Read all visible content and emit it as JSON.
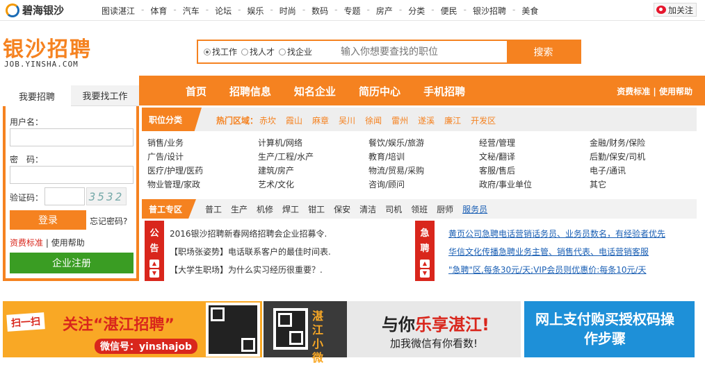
{
  "top_bar": {
    "logo_text": "碧海银沙",
    "nav": [
      "图读湛江",
      "体育",
      "汽车",
      "论坛",
      "娱乐",
      "时尚",
      "数码",
      "专题",
      "房产",
      "分类",
      "便民",
      "银沙招聘",
      "美食"
    ],
    "weibo_follow": "加关注"
  },
  "brand": {
    "title": "银沙招聘",
    "subtitle": "JOB.YINSHA.COM"
  },
  "search": {
    "options": [
      {
        "label": "找工作",
        "selected": true
      },
      {
        "label": "找人才",
        "selected": false
      },
      {
        "label": "找企业",
        "selected": false
      }
    ],
    "placeholder": "输入你想要查找的职位",
    "button": "搜索"
  },
  "main_nav": {
    "items": [
      "首页",
      "招聘信息",
      "知名企业",
      "简历中心",
      "手机招聘"
    ],
    "right": "资费标准 | 使用帮助"
  },
  "login": {
    "tabs": [
      "我要招聘",
      "我要找工作"
    ],
    "username_label": "用户名：",
    "password_label": "密　码：",
    "captcha_label": "验证码：",
    "captcha_text": "3532",
    "login_button": "登录",
    "forgot": "忘记密码?",
    "fee_link": "资费标准",
    "help_link": "使用帮助",
    "help_sep": " | ",
    "register_button": "企业注册"
  },
  "categories": {
    "title": "职位分类",
    "hot_label": "热门区域：",
    "hot_areas": [
      "赤坎",
      "霞山",
      "麻章",
      "吴川",
      "徐闻",
      "雷州",
      "遂溪",
      "廉江",
      "开发区"
    ],
    "grid": [
      "销售/业务",
      "计算机/网络",
      "餐饮/娱乐/旅游",
      "经营/管理",
      "金融/财务/保险",
      "广告/设计",
      "生产/工程/水产",
      "教育/培训",
      "文秘/翻译",
      "后勤/保安/司机",
      "医疗/护理/医药",
      "建筑/房产",
      "物流/贸易/采购",
      "客服/售后",
      "电子/通讯",
      "物业管理/家政",
      "艺术/文化",
      "咨询/顾问",
      "政府/事业单位",
      "其它"
    ]
  },
  "general_work": {
    "title": "普工专区",
    "items": [
      "普工",
      "生产",
      "机修",
      "焊工",
      "钳工",
      "保安",
      "清洁",
      "司机",
      "领班",
      "厨师",
      "服务员"
    ]
  },
  "notice": {
    "badge": [
      "公",
      "告"
    ],
    "items": [
      "2016银沙招聘新春网络招聘会企业招募令.",
      "【职场张姿势】电话联系客户的最佳时间表.",
      "【大学生职场】为什么实习经历很重要？."
    ]
  },
  "urgent": {
    "badge": [
      "急",
      "聘"
    ],
    "items": [
      "黄页公司急聘电话营销话务员、业务员数名，有经验者优先",
      "华信文化传播急聘业务主管、销售代表、电话营销客服",
      "\"急聘\"区,每条30元/天;VIP会员则优惠价:每条10元/天"
    ]
  },
  "banners": {
    "b1": {
      "tag": "扫一扫",
      "main": "关注“湛江招聘”",
      "wechat": "微信号：yinshajob"
    },
    "b2": {
      "label": "湛江小微",
      "main_pre": "与你",
      "main_hl": "乐享湛江!",
      "sub": "加我微信有你看数!"
    },
    "b3": {
      "text": "网上支付购买授权码操作步骤"
    }
  },
  "colors": {
    "accent": "#f58220",
    "green": "#3a9d23",
    "red": "#d9261c",
    "link": "#1a5fb4"
  }
}
